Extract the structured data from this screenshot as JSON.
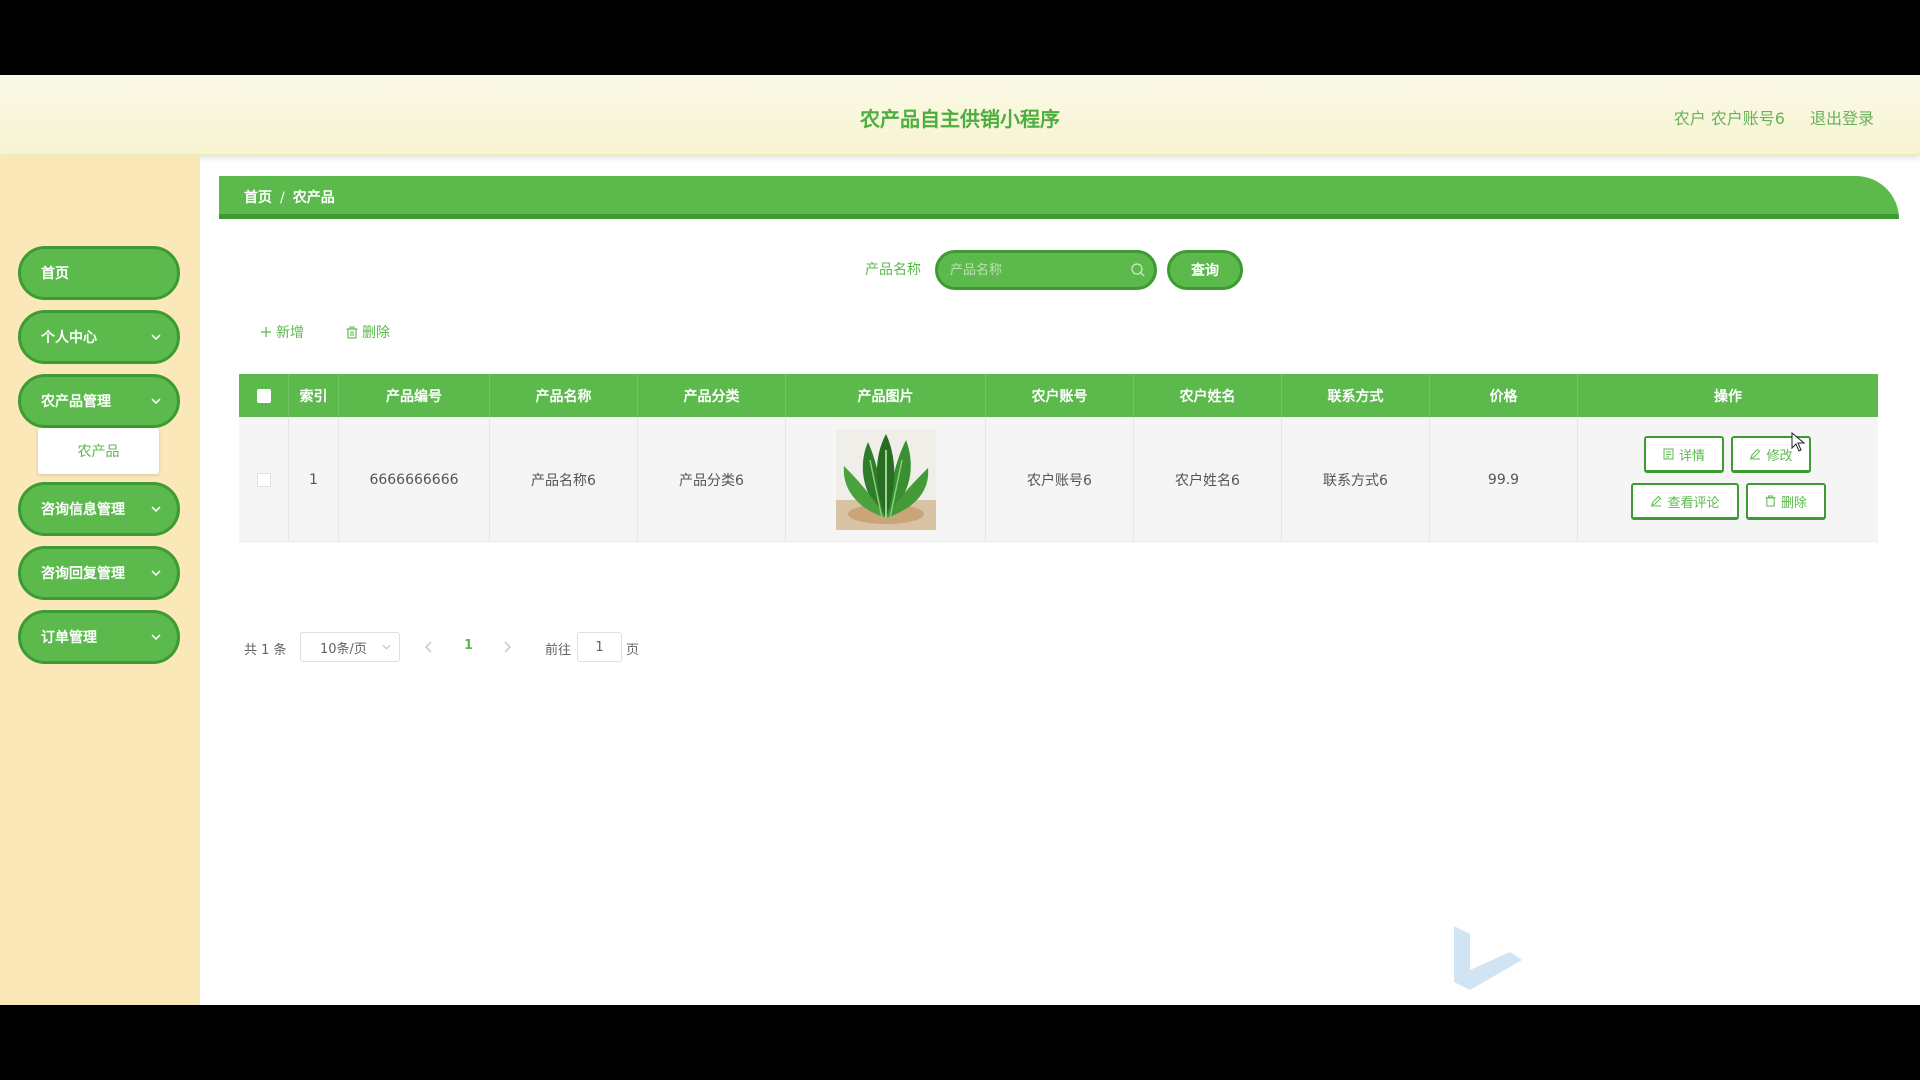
{
  "header": {
    "title": "农产品自主供销小程序",
    "user": "农户 农户账号6",
    "logout": "退出登录"
  },
  "sidebar": {
    "items": [
      {
        "label": "首页",
        "has_chevron": false
      },
      {
        "label": "个人中心",
        "has_chevron": true
      },
      {
        "label": "农产品管理",
        "has_chevron": true
      },
      {
        "label": "咨询信息管理",
        "has_chevron": true
      },
      {
        "label": "咨询回复管理",
        "has_chevron": true
      },
      {
        "label": "订单管理",
        "has_chevron": true
      }
    ],
    "submenu": {
      "label": "农产品"
    }
  },
  "breadcrumb": {
    "home": "首页",
    "separator": "/",
    "current": "农产品"
  },
  "search": {
    "label": "产品名称",
    "placeholder": "产品名称",
    "button": "查询"
  },
  "actions": {
    "add": "新增",
    "delete": "删除"
  },
  "table": {
    "columns": [
      "索引",
      "产品编号",
      "产品名称",
      "产品分类",
      "产品图片",
      "农户账号",
      "农户姓名",
      "联系方式",
      "价格",
      "操作"
    ],
    "rows": [
      {
        "index": "1",
        "code": "6666666666",
        "name": "产品名称6",
        "category": "产品分类6",
        "account": "农户账号6",
        "farmer": "农户姓名6",
        "contact": "联系方式6",
        "price": "99.9"
      }
    ],
    "row_actions": {
      "detail": "详情",
      "edit": "修改",
      "review": "查看评论",
      "delete": "删除"
    }
  },
  "pagination": {
    "total": "共 1 条",
    "page_size": "10条/页",
    "current": "1",
    "goto_label": "前往",
    "goto_value": "1",
    "page_suffix": "页"
  },
  "colors": {
    "primary": "#5cb94c",
    "primary_dark": "#3e9a33",
    "sidebar_bg": "#fbe8b9",
    "header_bg": "#f7f4d0"
  }
}
